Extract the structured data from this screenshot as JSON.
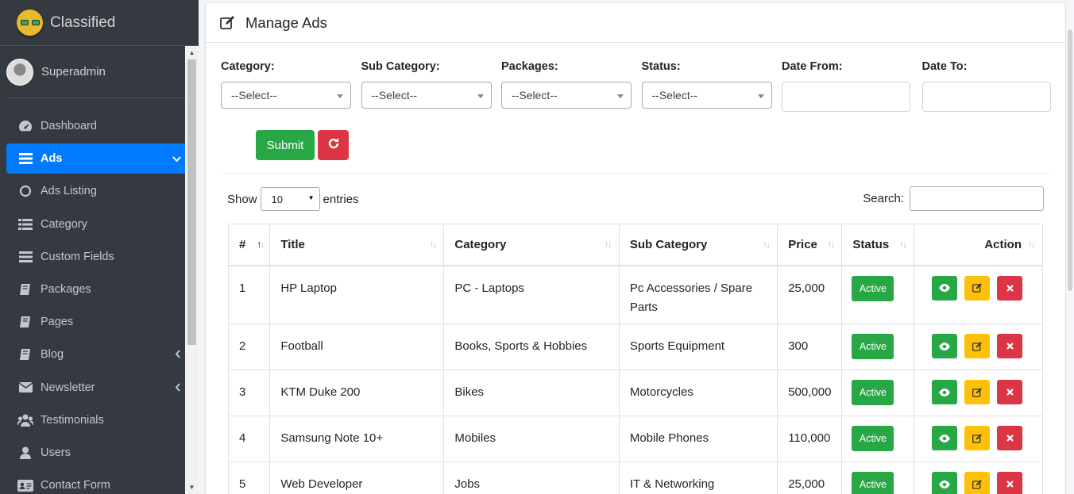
{
  "brand": {
    "name": "Classified"
  },
  "user": {
    "name": "Superadmin"
  },
  "sidebar": {
    "items": [
      {
        "label": "Dashboard",
        "icon": "dashboard-icon"
      },
      {
        "label": "Ads",
        "icon": "bars-icon",
        "active": true
      },
      {
        "label": "Ads Listing",
        "icon": "circle-icon"
      },
      {
        "label": "Category",
        "icon": "list-icon"
      },
      {
        "label": "Custom Fields",
        "icon": "bars-icon"
      },
      {
        "label": "Packages",
        "icon": "book-icon"
      },
      {
        "label": "Pages",
        "icon": "book-icon"
      },
      {
        "label": "Blog",
        "icon": "book-icon"
      },
      {
        "label": "Newsletter",
        "icon": "envelope-icon"
      },
      {
        "label": "Testimonials",
        "icon": "users-icon"
      },
      {
        "label": "Users",
        "icon": "user-icon"
      },
      {
        "label": "Contact Form",
        "icon": "address-card-icon"
      }
    ]
  },
  "page": {
    "title": "Manage Ads"
  },
  "filters": {
    "category": {
      "label": "Category:",
      "value": "--Select--"
    },
    "subcategory": {
      "label": "Sub Category:",
      "value": "--Select--"
    },
    "packages": {
      "label": "Packages:",
      "value": "--Select--"
    },
    "status": {
      "label": "Status:",
      "value": "--Select--"
    },
    "date_from": {
      "label": "Date From:"
    },
    "date_to": {
      "label": "Date To:"
    },
    "submit_label": "Submit"
  },
  "table_controls": {
    "show": "Show",
    "entries_value": "10",
    "entries": "entries",
    "search_label": "Search:"
  },
  "table": {
    "headers": [
      "#",
      "Title",
      "Category",
      "Sub Category",
      "Price",
      "Status",
      "Action"
    ],
    "rows": [
      {
        "num": "1",
        "title": "HP Laptop",
        "category": "PC - Laptops",
        "subcategory": "Pc Accessories / Spare Parts",
        "price": "25,000",
        "status": "Active"
      },
      {
        "num": "2",
        "title": "Football",
        "category": "Books, Sports & Hobbies",
        "subcategory": "Sports Equipment",
        "price": "300",
        "status": "Active"
      },
      {
        "num": "3",
        "title": "KTM Duke 200",
        "category": "Bikes",
        "subcategory": "Motorcycles",
        "price": "500,000",
        "status": "Active"
      },
      {
        "num": "4",
        "title": "Samsung Note 10+",
        "category": "Mobiles",
        "subcategory": "Mobile Phones",
        "price": "110,000",
        "status": "Active"
      },
      {
        "num": "5",
        "title": "Web Developer",
        "category": "Jobs",
        "subcategory": "IT & Networking",
        "price": "25,000",
        "status": "Active"
      }
    ]
  },
  "colors": {
    "primary": "#007bff",
    "success": "#28a745",
    "warning": "#ffc107",
    "danger": "#dc3545",
    "sidebar": "#343a40"
  }
}
